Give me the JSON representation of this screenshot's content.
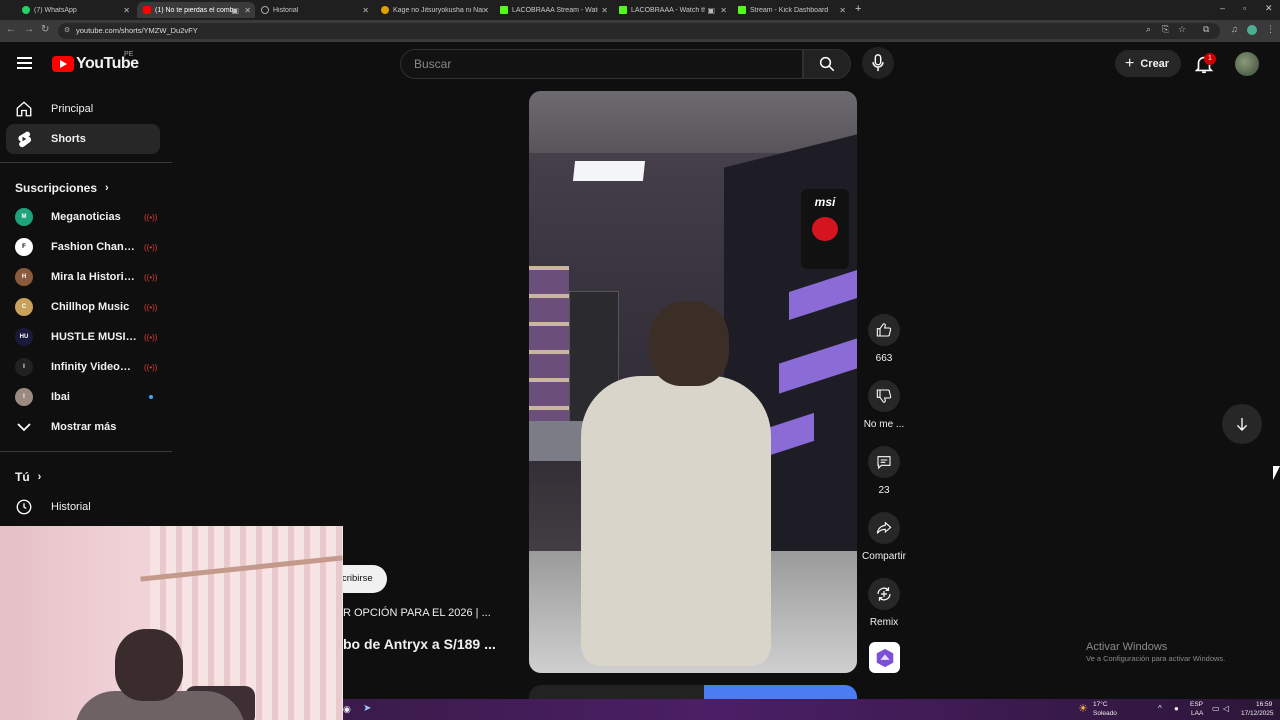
{
  "browser": {
    "tabs": [
      {
        "label": "(7) WhatsApp",
        "color": "#25d366"
      },
      {
        "label": "(1) No te pierdas el combo",
        "color": "#ff0000"
      },
      {
        "label": "Historial",
        "color": "#9e9e9e"
      },
      {
        "label": "Kage no Jitsuryokusha ni Narit",
        "color": "#e0a000"
      },
      {
        "label": "LACOBRAAA Stream - Watch Li",
        "color": "#53fc18"
      },
      {
        "label": "LACOBRAAA - Watch the V",
        "color": "#53fc18"
      },
      {
        "label": "Stream - Kick Dashboard",
        "color": "#53fc18"
      }
    ],
    "url": "youtube.com/shorts/YMZW_Du2vFY"
  },
  "header": {
    "logo_text": "YouTube",
    "region": "PE",
    "search_placeholder": "Buscar",
    "create_label": "Crear",
    "notification_count": "1"
  },
  "sidebar": {
    "main": [
      {
        "label": "Principal",
        "icon": "home-icon"
      },
      {
        "label": "Shorts",
        "icon": "shorts-icon",
        "active": true
      }
    ],
    "subs_heading": "Suscripciones",
    "subscriptions": [
      {
        "name": "Meganoticias",
        "color": "#1fa37a",
        "initials": "M",
        "live": true
      },
      {
        "name": "Fashion Channel",
        "color": "#ffffff",
        "initials": "F",
        "live": true
      },
      {
        "name": "Mira la Historia /...",
        "color": "#8a5a3c",
        "initials": "H",
        "live": true
      },
      {
        "name": "Chillhop Music",
        "color": "#c9a15a",
        "initials": "C",
        "live": true
      },
      {
        "name": "HUSTLE MUSIC (...",
        "color": "#1a1a3a",
        "initials": "HU",
        "live": true
      },
      {
        "name": "Infinity VideoHU...",
        "color": "#222222",
        "initials": "I",
        "live": true
      },
      {
        "name": "Ibai",
        "color": "#9c8a80",
        "initials": "I",
        "live": false
      }
    ],
    "show_more": "Mostrar más",
    "you_heading": "Tú",
    "history": "Historial"
  },
  "short": {
    "subscribe_partial": "cribirse",
    "line1_partial": "R OPCIÓN PARA EL 2026 | ...",
    "line2_partial": "bo de Antryx a S/189 ...",
    "brand_on_wall": "msi"
  },
  "actions": {
    "likes": "663",
    "dislike_label": "No me ...",
    "comments": "23",
    "share_label": "Compartir",
    "remix_label": "Remix"
  },
  "windows": {
    "activate_title": "Activar Windows",
    "activate_sub": "Ve a Configuración para activar Windows.",
    "temp": "17°C",
    "weather": "Soleado",
    "lang1": "ESP",
    "lang2": "LAA",
    "time": "16:59",
    "date": "17/12/2025"
  }
}
